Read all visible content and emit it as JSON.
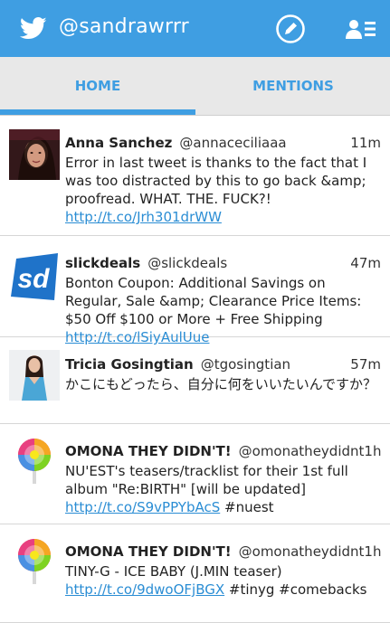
{
  "header": {
    "handle": "@sandrawrrr",
    "brand_color": "#3f9ee2",
    "icons": [
      "twitter-bird-icon",
      "compose-icon",
      "people-icon"
    ]
  },
  "tabs": [
    {
      "label": "HOME",
      "active": true
    },
    {
      "label": "MENTIONS",
      "active": false
    }
  ],
  "tweets": [
    {
      "name": "Anna Sanchez",
      "screen_name": "@annaceciliaaa",
      "time": "11m",
      "text": "Error in last tweet is thanks to the fact that I was too distracted by this to go back &amp; proofread. WHAT. THE. FUCK?! ",
      "link": "http://t.co/Jrh301drWW",
      "suffix": ""
    },
    {
      "name": "slickdeals",
      "screen_name": "@slickdeals",
      "time": "47m",
      "text": "Bonton Coupon: Additional Savings on Regular, Sale &amp; Clearance Price Items: $50 Off $100 or More + Free Shipping ",
      "link": "http://t.co/lSiyAulUue",
      "suffix": ""
    },
    {
      "name": "Tricia Gosingtian",
      "screen_name": "@tgosingtian",
      "time": "57m",
      "text": "かこにもどったら、自分に何をいいたいんですか？",
      "link": "",
      "suffix": ""
    },
    {
      "name": "OMONA THEY DIDN'T!",
      "screen_name": "@omonatheydidnt",
      "time": "1h",
      "text": "NU'EST's teasers/tracklist for their 1st full album \"Re:BIRTH\" [will be updated] ",
      "link": "http://t.co/S9vPPYbAcS",
      "suffix": " #nuest"
    },
    {
      "name": "OMONA THEY DIDN'T!",
      "screen_name": "@omonatheydidnt",
      "time": "1h",
      "text": "TINY-G - ICE BABY (J.MIN teaser) ",
      "link": "http://t.co/9dwoOFjBGX",
      "suffix": " #tinyg #comebacks"
    }
  ]
}
